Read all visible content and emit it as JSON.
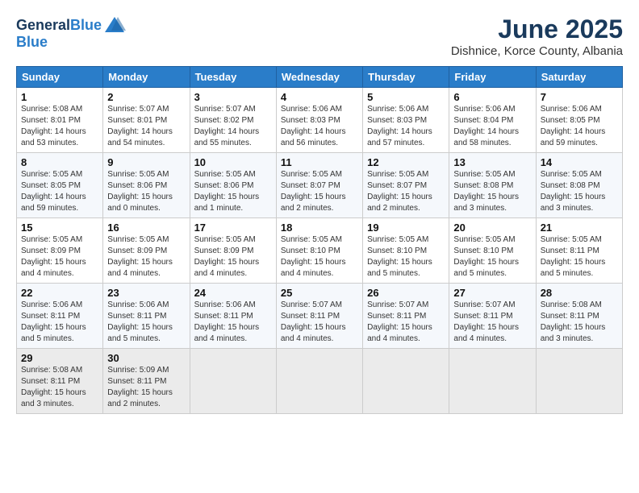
{
  "header": {
    "logo_line1": "General",
    "logo_line2": "Blue",
    "month": "June 2025",
    "location": "Dishnice, Korce County, Albania"
  },
  "weekdays": [
    "Sunday",
    "Monday",
    "Tuesday",
    "Wednesday",
    "Thursday",
    "Friday",
    "Saturday"
  ],
  "weeks": [
    [
      {
        "day": "1",
        "info": "Sunrise: 5:08 AM\nSunset: 8:01 PM\nDaylight: 14 hours\nand 53 minutes."
      },
      {
        "day": "2",
        "info": "Sunrise: 5:07 AM\nSunset: 8:01 PM\nDaylight: 14 hours\nand 54 minutes."
      },
      {
        "day": "3",
        "info": "Sunrise: 5:07 AM\nSunset: 8:02 PM\nDaylight: 14 hours\nand 55 minutes."
      },
      {
        "day": "4",
        "info": "Sunrise: 5:06 AM\nSunset: 8:03 PM\nDaylight: 14 hours\nand 56 minutes."
      },
      {
        "day": "5",
        "info": "Sunrise: 5:06 AM\nSunset: 8:03 PM\nDaylight: 14 hours\nand 57 minutes."
      },
      {
        "day": "6",
        "info": "Sunrise: 5:06 AM\nSunset: 8:04 PM\nDaylight: 14 hours\nand 58 minutes."
      },
      {
        "day": "7",
        "info": "Sunrise: 5:06 AM\nSunset: 8:05 PM\nDaylight: 14 hours\nand 59 minutes."
      }
    ],
    [
      {
        "day": "8",
        "info": "Sunrise: 5:05 AM\nSunset: 8:05 PM\nDaylight: 14 hours\nand 59 minutes."
      },
      {
        "day": "9",
        "info": "Sunrise: 5:05 AM\nSunset: 8:06 PM\nDaylight: 15 hours\nand 0 minutes."
      },
      {
        "day": "10",
        "info": "Sunrise: 5:05 AM\nSunset: 8:06 PM\nDaylight: 15 hours\nand 1 minute."
      },
      {
        "day": "11",
        "info": "Sunrise: 5:05 AM\nSunset: 8:07 PM\nDaylight: 15 hours\nand 2 minutes."
      },
      {
        "day": "12",
        "info": "Sunrise: 5:05 AM\nSunset: 8:07 PM\nDaylight: 15 hours\nand 2 minutes."
      },
      {
        "day": "13",
        "info": "Sunrise: 5:05 AM\nSunset: 8:08 PM\nDaylight: 15 hours\nand 3 minutes."
      },
      {
        "day": "14",
        "info": "Sunrise: 5:05 AM\nSunset: 8:08 PM\nDaylight: 15 hours\nand 3 minutes."
      }
    ],
    [
      {
        "day": "15",
        "info": "Sunrise: 5:05 AM\nSunset: 8:09 PM\nDaylight: 15 hours\nand 4 minutes."
      },
      {
        "day": "16",
        "info": "Sunrise: 5:05 AM\nSunset: 8:09 PM\nDaylight: 15 hours\nand 4 minutes."
      },
      {
        "day": "17",
        "info": "Sunrise: 5:05 AM\nSunset: 8:09 PM\nDaylight: 15 hours\nand 4 minutes."
      },
      {
        "day": "18",
        "info": "Sunrise: 5:05 AM\nSunset: 8:10 PM\nDaylight: 15 hours\nand 4 minutes."
      },
      {
        "day": "19",
        "info": "Sunrise: 5:05 AM\nSunset: 8:10 PM\nDaylight: 15 hours\nand 5 minutes."
      },
      {
        "day": "20",
        "info": "Sunrise: 5:05 AM\nSunset: 8:10 PM\nDaylight: 15 hours\nand 5 minutes."
      },
      {
        "day": "21",
        "info": "Sunrise: 5:05 AM\nSunset: 8:11 PM\nDaylight: 15 hours\nand 5 minutes."
      }
    ],
    [
      {
        "day": "22",
        "info": "Sunrise: 5:06 AM\nSunset: 8:11 PM\nDaylight: 15 hours\nand 5 minutes."
      },
      {
        "day": "23",
        "info": "Sunrise: 5:06 AM\nSunset: 8:11 PM\nDaylight: 15 hours\nand 5 minutes."
      },
      {
        "day": "24",
        "info": "Sunrise: 5:06 AM\nSunset: 8:11 PM\nDaylight: 15 hours\nand 4 minutes."
      },
      {
        "day": "25",
        "info": "Sunrise: 5:07 AM\nSunset: 8:11 PM\nDaylight: 15 hours\nand 4 minutes."
      },
      {
        "day": "26",
        "info": "Sunrise: 5:07 AM\nSunset: 8:11 PM\nDaylight: 15 hours\nand 4 minutes."
      },
      {
        "day": "27",
        "info": "Sunrise: 5:07 AM\nSunset: 8:11 PM\nDaylight: 15 hours\nand 4 minutes."
      },
      {
        "day": "28",
        "info": "Sunrise: 5:08 AM\nSunset: 8:11 PM\nDaylight: 15 hours\nand 3 minutes."
      }
    ],
    [
      {
        "day": "29",
        "info": "Sunrise: 5:08 AM\nSunset: 8:11 PM\nDaylight: 15 hours\nand 3 minutes."
      },
      {
        "day": "30",
        "info": "Sunrise: 5:09 AM\nSunset: 8:11 PM\nDaylight: 15 hours\nand 2 minutes."
      },
      {
        "day": "",
        "info": ""
      },
      {
        "day": "",
        "info": ""
      },
      {
        "day": "",
        "info": ""
      },
      {
        "day": "",
        "info": ""
      },
      {
        "day": "",
        "info": ""
      }
    ]
  ]
}
